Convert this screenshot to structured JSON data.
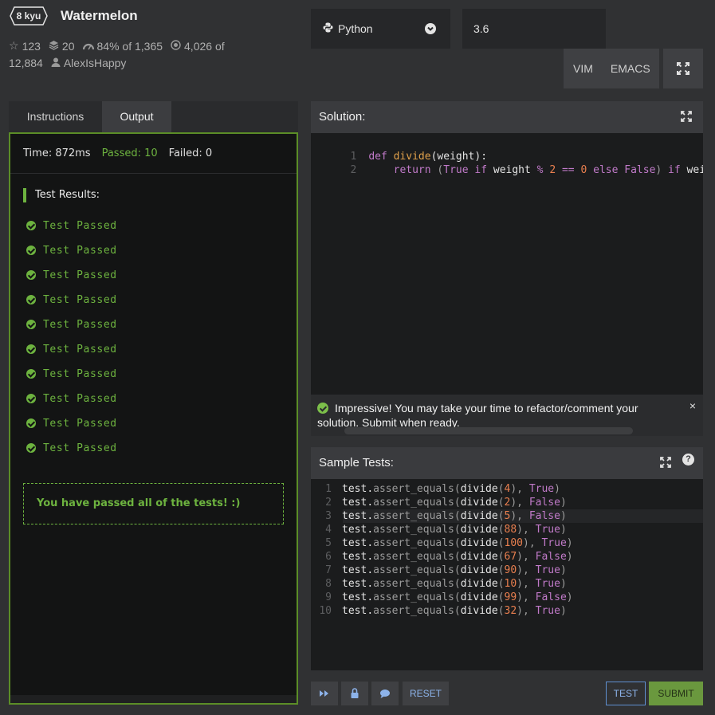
{
  "kata": {
    "rank": "8 kyu",
    "title": "Watermelon",
    "stars": "123",
    "collections": "20",
    "satisfaction": "84% of 1,365",
    "completions_a": "4,026 of",
    "completions_b": "12,884",
    "author": "AlexIsHappy"
  },
  "toolbar": {
    "language": "Python",
    "version": "3.6",
    "modes": [
      "VIM",
      "EMACS"
    ]
  },
  "tabs": [
    {
      "label": "Instructions",
      "active": false
    },
    {
      "label": "Output",
      "active": true
    }
  ],
  "output": {
    "time_label": "Time: 872ms",
    "passed_label": "Passed: 10",
    "failed_label": "Failed: 0",
    "results_title": "Test Results:",
    "results": [
      "Test Passed",
      "Test Passed",
      "Test Passed",
      "Test Passed",
      "Test Passed",
      "Test Passed",
      "Test Passed",
      "Test Passed",
      "Test Passed",
      "Test Passed"
    ],
    "summary": "You have passed all of the tests! :)"
  },
  "solution": {
    "title": "Solution:",
    "line_numbers": [
      "1",
      "2"
    ],
    "line1": {
      "kw": "def",
      "fn": "divide",
      "rest": "(weight):"
    },
    "line2": {
      "indent": "    ",
      "kw": "return",
      "p1": " (",
      "b1": "True",
      "kw2": " if",
      "t1": " weight",
      "op": " %",
      "n1": " 2",
      "op2": " ==",
      "n2": " 0",
      "kw3": " else",
      "b2": " False",
      "p2": ")",
      "kw4": " if",
      "t2": " weight"
    }
  },
  "notice": {
    "text": "Impressive! You may take your time to refactor/comment your solution. Submit when ready.",
    "close": "×"
  },
  "sample_tests": {
    "title": "Sample Tests:",
    "help": "?",
    "lines": [
      {
        "num": "1",
        "arg": "4",
        "res": "True"
      },
      {
        "num": "2",
        "arg": "2",
        "res": "False"
      },
      {
        "num": "3",
        "arg": "5",
        "res": "False"
      },
      {
        "num": "4",
        "arg": "88",
        "res": "True"
      },
      {
        "num": "5",
        "arg": "100",
        "res": "True"
      },
      {
        "num": "6",
        "arg": "67",
        "res": "False"
      },
      {
        "num": "7",
        "arg": "90",
        "res": "True"
      },
      {
        "num": "8",
        "arg": "10",
        "res": "True"
      },
      {
        "num": "9",
        "arg": "99",
        "res": "False"
      },
      {
        "num": "10",
        "arg": "32",
        "res": "True"
      }
    ],
    "prefix": "test",
    "dot": ".",
    "method": "assert_equals",
    "open": "(",
    "fn": "divide",
    "close_call": ")",
    "sep": ", ",
    "end": ")"
  },
  "bottom": {
    "reset": "RESET",
    "test": "TEST",
    "submit": "SUBMIT"
  }
}
